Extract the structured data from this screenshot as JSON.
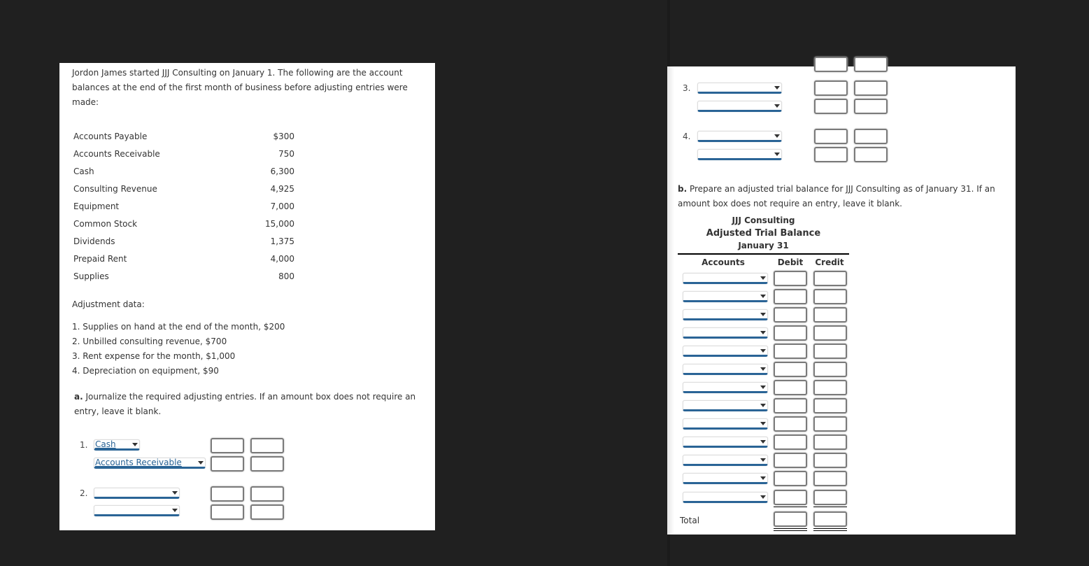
{
  "problem": {
    "intro": "Jordon James started JJJ Consulting on January 1. The following are the account balances at the end of the first month of business before adjusting entries were made:",
    "balances": [
      {
        "account": "Accounts Payable",
        "amount": "$300"
      },
      {
        "account": "Accounts Receivable",
        "amount": "750"
      },
      {
        "account": "Cash",
        "amount": "6,300"
      },
      {
        "account": "Consulting Revenue",
        "amount": "4,925"
      },
      {
        "account": "Equipment",
        "amount": "7,000"
      },
      {
        "account": "Common Stock",
        "amount": "15,000"
      },
      {
        "account": "Dividends",
        "amount": "1,375"
      },
      {
        "account": "Prepaid Rent",
        "amount": "4,000"
      },
      {
        "account": "Supplies",
        "amount": "800"
      }
    ],
    "adjustment_title": "Adjustment data:",
    "adjustments": [
      "1. Supplies on hand at the end of the month, $200",
      "2. Unbilled consulting revenue, $700",
      "3. Rent expense for the month, $1,000",
      "4. Depreciation on equipment, $90"
    ]
  },
  "part_a": {
    "label": "a.",
    "instruction": " Journalize the required adjusting entries. If an amount box does not require an entry, leave it blank.",
    "entries": [
      {
        "number": "1.",
        "lines": [
          {
            "account": "Cash",
            "debit": "",
            "credit": ""
          },
          {
            "account": "Accounts Receivable",
            "debit": "",
            "credit": ""
          }
        ]
      },
      {
        "number": "2.",
        "lines": [
          {
            "account": "",
            "debit": "",
            "credit": ""
          },
          {
            "account": "",
            "debit": "",
            "credit": ""
          }
        ]
      },
      {
        "number": "3.",
        "lines": [
          {
            "account": "",
            "debit": "",
            "credit": ""
          },
          {
            "account": "",
            "debit": "",
            "credit": ""
          }
        ]
      },
      {
        "number": "4.",
        "lines": [
          {
            "account": "",
            "debit": "",
            "credit": ""
          },
          {
            "account": "",
            "debit": "",
            "credit": ""
          }
        ]
      }
    ]
  },
  "part_b": {
    "label": "b.",
    "instruction": " Prepare an adjusted trial balance for JJJ Consulting as of January 31. If an amount box does not require an entry, leave it blank.",
    "company": "JJJ Consulting",
    "statement": "Adjusted Trial Balance",
    "date": "January 31",
    "columns": {
      "accounts": "Accounts",
      "debit": "Debit",
      "credit": "Credit"
    },
    "row_count": 13,
    "total_label": "Total"
  },
  "colors": {
    "background": "#202020",
    "panel": "#ffffff",
    "select_accent": "#2a6496",
    "box_border": "#7a7a7a"
  }
}
